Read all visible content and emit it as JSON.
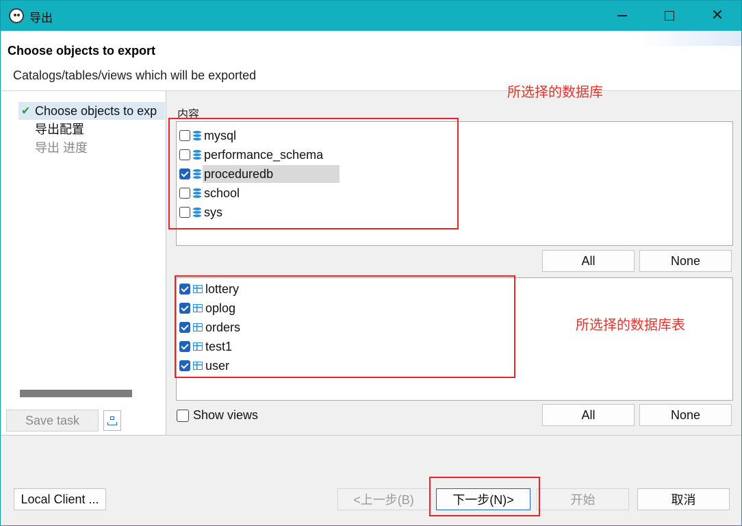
{
  "window": {
    "title": "导出",
    "icon": "app-logo-icon"
  },
  "header": {
    "title": "Choose objects to export",
    "description": "Catalogs/tables/views which will be exported"
  },
  "annotations": {
    "databases_note": "所选择的数据库",
    "tables_note": "所选择的数据库表"
  },
  "nav": {
    "items": [
      {
        "label": "Choose objects to exp",
        "state": "done"
      },
      {
        "label": "导出配置",
        "state": "pending"
      },
      {
        "label": "导出 进度",
        "state": "disabled"
      }
    ],
    "save_task": "Save task"
  },
  "content": {
    "label": "内容",
    "databases": [
      {
        "name": "mysql",
        "checked": false
      },
      {
        "name": "performance_schema",
        "checked": false
      },
      {
        "name": "proceduredb",
        "checked": true,
        "selected": true
      },
      {
        "name": "school",
        "checked": false
      },
      {
        "name": "sys",
        "checked": false
      }
    ],
    "tables": [
      {
        "name": "lottery",
        "checked": true
      },
      {
        "name": "oplog",
        "checked": true
      },
      {
        "name": "orders",
        "checked": true
      },
      {
        "name": "test1",
        "checked": true
      },
      {
        "name": "user",
        "checked": true
      }
    ],
    "all_label": "All",
    "none_label": "None",
    "show_views_label": "Show views",
    "show_views_checked": false
  },
  "footer": {
    "local_client": "Local Client ...",
    "back": "<上一步(B)",
    "next": "下一步(N)>",
    "start": "开始",
    "cancel": "取消"
  },
  "colors": {
    "titlebar": "#13b1c0",
    "annotation": "#e8242a",
    "checkbox_on": "#1f63b8"
  }
}
